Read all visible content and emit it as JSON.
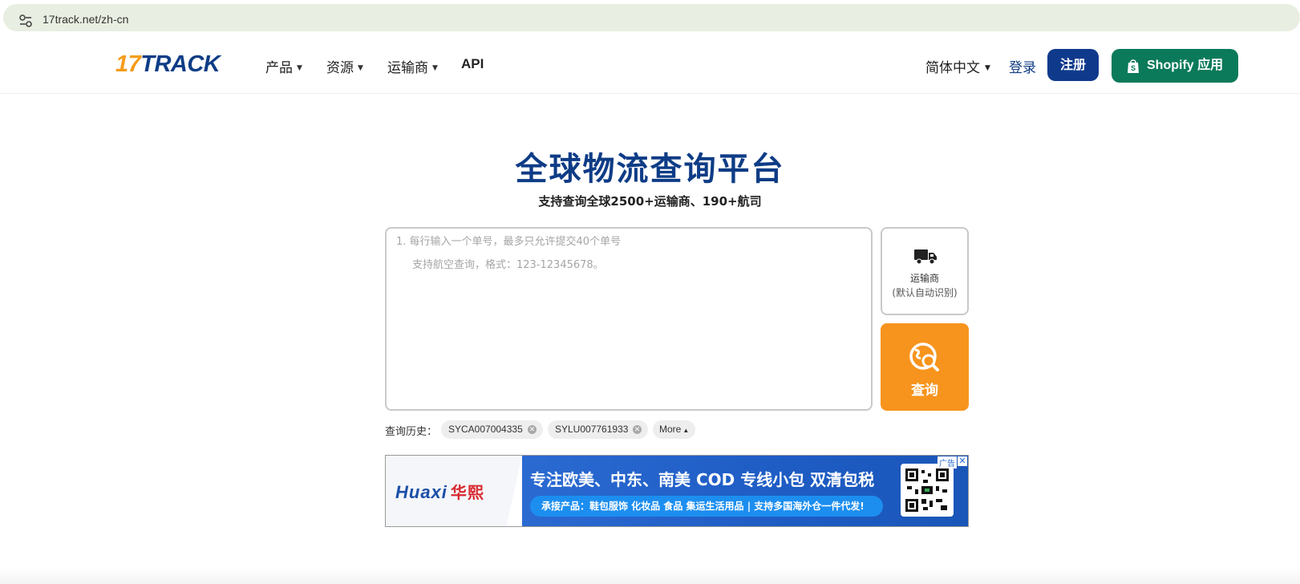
{
  "browser": {
    "url": "17track.net/zh-cn",
    "tune_icon": "tune-icon"
  },
  "header": {
    "logo_17": "17",
    "logo_track": "TRACK",
    "nav": [
      {
        "label": "产品",
        "has_caret": true
      },
      {
        "label": "资源",
        "has_caret": true
      },
      {
        "label": "运输商",
        "has_caret": true
      },
      {
        "label": "API",
        "has_caret": false
      }
    ],
    "language": "简体中文",
    "login": "登录",
    "register": "注册",
    "shopify": "Shopify 应用",
    "colors": {
      "brand_blue": "#0e3c86",
      "brand_orange": "#f59c1a",
      "shopify_green": "#0b7a5a"
    }
  },
  "hero": {
    "title": "全球物流查询平台",
    "subtitle": "支持查询全球2500+运输商、190+航司"
  },
  "tracking": {
    "placeholder_line1": "1. 每行输入一个单号，最多只允许提交40个单号",
    "placeholder_line2": "支持航空查询，格式：123-12345678。",
    "carrier_label": "运输商",
    "carrier_sub": "(默认自动识别)",
    "query_label": "查询",
    "query_color": "#f7941d"
  },
  "history": {
    "label": "查询历史：",
    "items": [
      "SYCA007004335",
      "SYLU007761933"
    ],
    "more": "More"
  },
  "ad": {
    "brand_latin": "Huaxi",
    "brand_cn": "华熙",
    "headline": "专注欧美、中东、南美 COD 专线小包   双清包税",
    "subline": "承接产品：鞋包服饰 化妆品 食品 集运生活用品 | 支持多国海外仓一件代发!",
    "tag": "广告",
    "close": "✕"
  }
}
